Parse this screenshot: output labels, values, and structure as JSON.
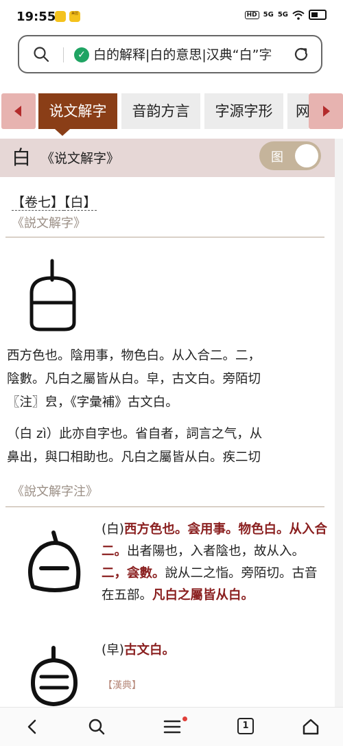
{
  "status": {
    "time": "19:55",
    "app_badge_text": "美团",
    "hd": "HD",
    "signal1": "5G",
    "signal2": "5G"
  },
  "urlbar": {
    "url_text": "白的解释|白的意思|汉典“白”字"
  },
  "tabs": [
    "说文解字",
    "音韵方言",
    "字源字形",
    "网"
  ],
  "header": {
    "char": "白",
    "book": "《说文解字》",
    "toggle_label": "图"
  },
  "entry": {
    "volume_open": "【卷七】",
    "volume_char": "【白】",
    "source1": "《説文解字》",
    "para1_line1": "西方色也。陰用事，物色白。从入合二。二，",
    "para1_line2": "陰數。凡白之屬皆从白。皁，古文白。旁陌切",
    "para1_line3": "〖注〗㿝，《字彙補》古文白。",
    "para2_line1": "（白 zì）此亦自字也。省自者，詞言之气，从",
    "para2_line2": "鼻出，與口相助也。凡白之屬皆从白。疾二切",
    "source2": "《說文解字注》",
    "duan_1_prefix": "(白)",
    "duan_1_red_a": "西方色也。侌用事。物色白。从入合二。",
    "duan_1_plain_a": "出者陽也，入者陰也，故从入。",
    "duan_1_red_b": "二，侌數。",
    "duan_1_plain_b": "說从二之恉。旁陌切。古音在五部。",
    "duan_1_red_c": "凡白之屬皆从白。",
    "duan_2_prefix": "(皁)",
    "duan_2_red": "古文白。",
    "han_label": "【漢典】"
  },
  "colors": {
    "active_tab": "#8a3e17",
    "arrow_bg": "#e7b3b0",
    "header_bg": "#e6d7d6",
    "annotation_red": "#8a1f1f",
    "source_gray": "#9b8f86"
  },
  "icons": [
    "search-icon",
    "shield-check-icon",
    "reload-icon",
    "back-icon",
    "search-nav-icon",
    "menu-icon",
    "tabs-count-icon",
    "home-icon"
  ],
  "bottom_nav": {
    "tab_count": "1"
  }
}
